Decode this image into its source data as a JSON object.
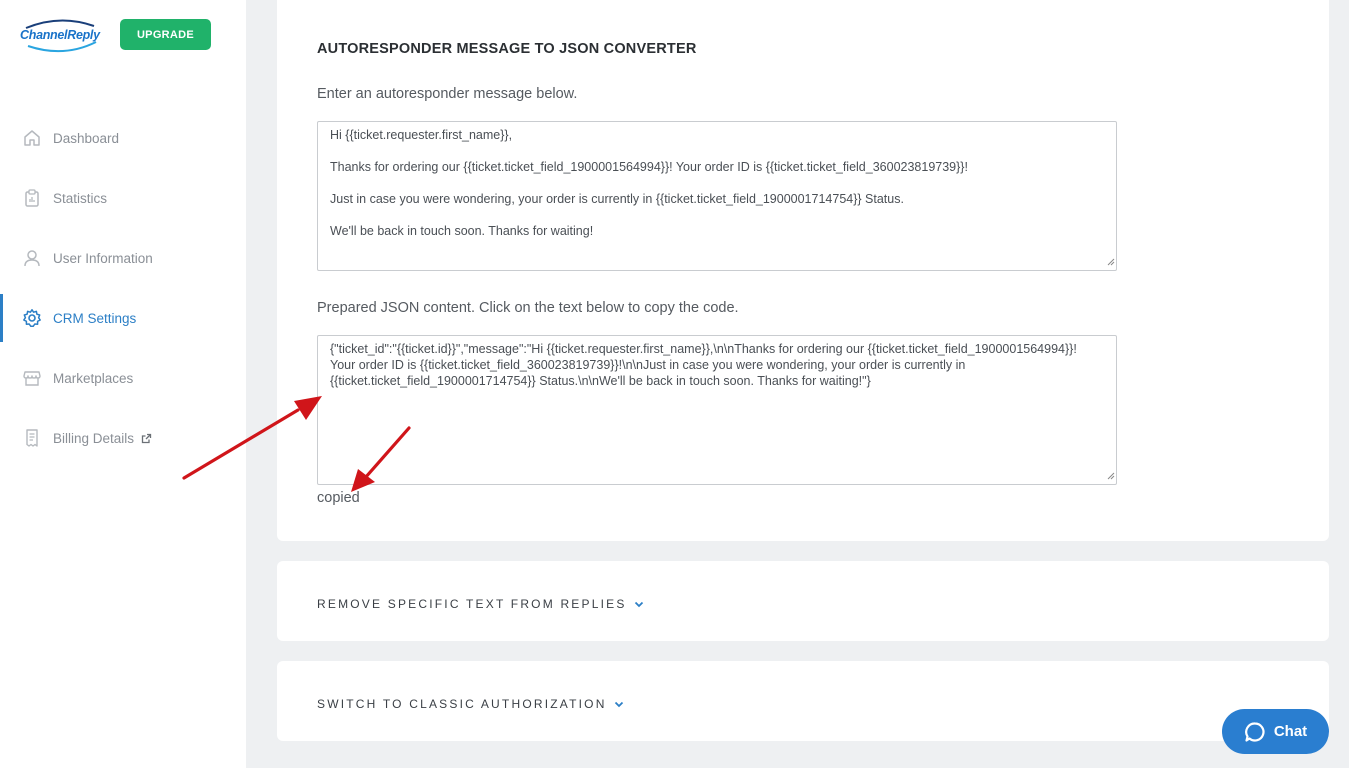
{
  "sidebar": {
    "logo_text": "ChannelReply",
    "upgrade_label": "UPGRADE",
    "items": [
      {
        "label": "Dashboard",
        "icon": "home-icon"
      },
      {
        "label": "Statistics",
        "icon": "clipboard-icon"
      },
      {
        "label": "User Information",
        "icon": "user-icon"
      },
      {
        "label": "CRM Settings",
        "icon": "gear-icon",
        "active": true
      },
      {
        "label": "Marketplaces",
        "icon": "store-icon"
      },
      {
        "label": "Billing Details",
        "icon": "receipt-icon",
        "external": true
      }
    ]
  },
  "converter": {
    "title": "AUTORESPONDER MESSAGE TO JSON CONVERTER",
    "input_label": "Enter an autoresponder message below.",
    "message_lines": [
      "Hi {{ticket.requester.first_name}},",
      "Thanks for ordering our {{ticket.ticket_field_1900001564994}}! Your order ID is {{ticket.ticket_field_360023819739}}!",
      "Just in case you were wondering, your order is currently in {{ticket.ticket_field_1900001714754}} Status.",
      "We'll be back in touch soon. Thanks for waiting!"
    ],
    "output_label": "Prepared JSON content. Click on the text below to copy the code.",
    "json_output": "{\"ticket_id\":\"{{ticket.id}}\",\"message\":\"Hi {{ticket.requester.first_name}},\\n\\nThanks for ordering our {{ticket.ticket_field_1900001564994}}! Your order ID is {{ticket.ticket_field_360023819739}}!\\n\\nJust in case you were wondering, your order is currently in {{ticket.ticket_field_1900001714754}} Status.\\n\\nWe'll be back in touch soon. Thanks for waiting!\"}",
    "copied_text": "copied"
  },
  "sections": {
    "remove_text": "REMOVE SPECIFIC TEXT FROM REPLIES",
    "classic_auth": "SWITCH TO CLASSIC AUTHORIZATION"
  },
  "chat": {
    "label": "Chat"
  },
  "colors": {
    "accent": "#2c7fc6",
    "upgrade": "#20b26a",
    "chat": "#2a7ed0",
    "arrow": "#d0151a"
  }
}
